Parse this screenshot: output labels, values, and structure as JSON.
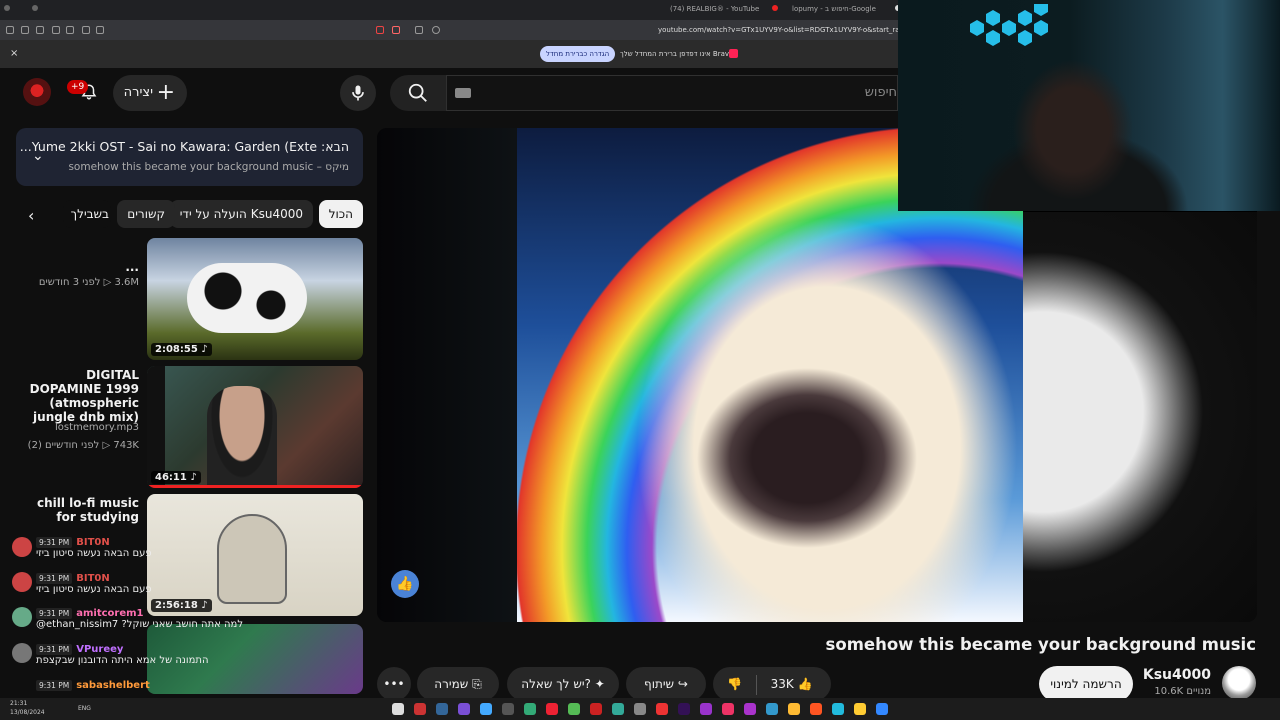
{
  "browser": {
    "tabs": [
      {
        "label": "(74) REALBIG® - YouTube"
      },
      {
        "label": "lopumy - חיפוש ב-Google"
      }
    ],
    "url": "youtube.com/watch?v=GTx1UYV9Y-o&list=RDGTx1UYV9Y-o&start_radio=1",
    "infobar": {
      "text": "Brave אינו דפדפן ברירת המחדל שלך",
      "button": "הגדרה כברירת מחדל"
    }
  },
  "header": {
    "create_label": "יצירה",
    "notification_count": "+9",
    "search_placeholder": "חיפוש"
  },
  "up_next": {
    "title": "הבא: Yume 2kki OST - Sai no Kawara: Garden (Exte...",
    "subtitle": "מיקס – somehow this became your background music"
  },
  "chips": [
    {
      "label": "הכול",
      "active": true
    },
    {
      "label": "הועלה על ידי Ksu4000"
    },
    {
      "label": "קשורים"
    },
    {
      "label": "בשבילך"
    }
  ],
  "recommendations": [
    {
      "title": "...",
      "meta1": "3.6M ▷  לפני 3 חודשים",
      "meta2": "",
      "duration": "2:08:55 ♪"
    },
    {
      "title": "DIGITAL DOPAMINE 1999 (atmospheric jungle dnb mix)",
      "meta1": "lostmemory.mp3",
      "meta2": "743K ▷  לפני חודשיים (2)",
      "duration": "46:11 ♪"
    },
    {
      "title": "chill lo-fi music for studying",
      "meta1": "",
      "meta2": "",
      "duration": "2:56:18 ♪"
    }
  ],
  "chat": [
    {
      "time": "9:31 PM",
      "user": "BIT0N",
      "msg": "פעם הבאה נעשה סיטון ביזי",
      "color": "#e0504a"
    },
    {
      "time": "9:31 PM",
      "user": "BIT0N",
      "msg": "פעם הבאה נעשה סיטון ביזי",
      "color": "#e0504a"
    },
    {
      "time": "9:31 PM",
      "user": "amitcorem1",
      "msg": "@ethan_nissim7 ?למה אתה חושב שאני שוקל",
      "color": "#ff6fb0"
    },
    {
      "time": "9:31 PM",
      "user": "VPureey",
      "msg": "התמונה של אמא היתה הדובנון שבקצפת",
      "color": "#c070ff"
    },
    {
      "time": "9:31 PM",
      "user": "sabashelbert",
      "msg": "",
      "color": "#ff9a3b"
    }
  ],
  "video": {
    "title": "somehow this became your background music",
    "channel": "Ksu4000",
    "subscribers": "10.6K מנויים",
    "subscribe_label": "הרשמה למינוי",
    "likes": "33K",
    "share_label": "שיתוף",
    "ask_label": "יש לך שאלה?",
    "save_label": "שמירה",
    "more_label": "•••"
  },
  "taskbar": {
    "time": "21:31",
    "date": "13/08/2024",
    "lang": "ENG"
  },
  "colors": {
    "accent": "#3ea6ff",
    "chip_active": "#f1f1f1",
    "card": "#1f2433"
  }
}
